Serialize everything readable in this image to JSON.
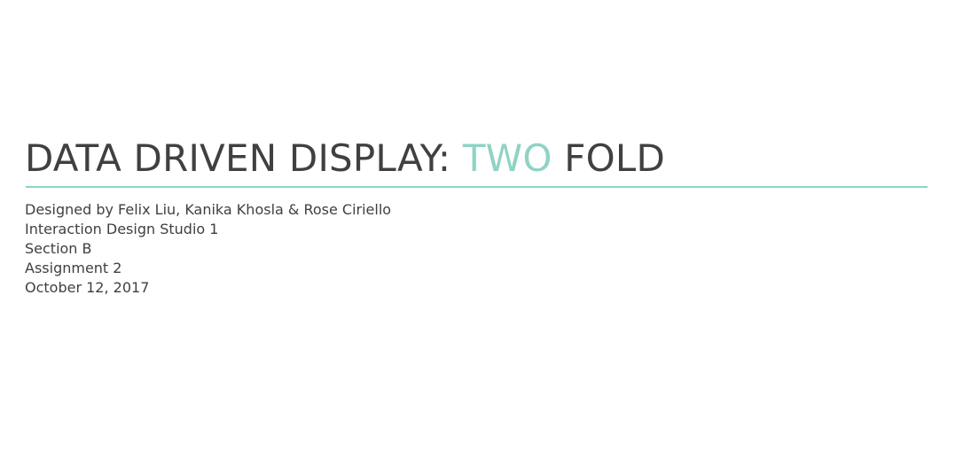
{
  "title": {
    "part1": "DATA DRIVEN DISPLAY: ",
    "accent": "TWO",
    "part2": " FOLD"
  },
  "details": [
    "Designed by Felix Liu, Kanika Khosla & Rose Ciriello",
    "Interaction Design Studio 1",
    "Section B",
    "Assignment 2",
    "October 12, 2017"
  ],
  "colors": {
    "text": "#404040",
    "accent": "#8fd3c5",
    "background": "#ffffff"
  }
}
